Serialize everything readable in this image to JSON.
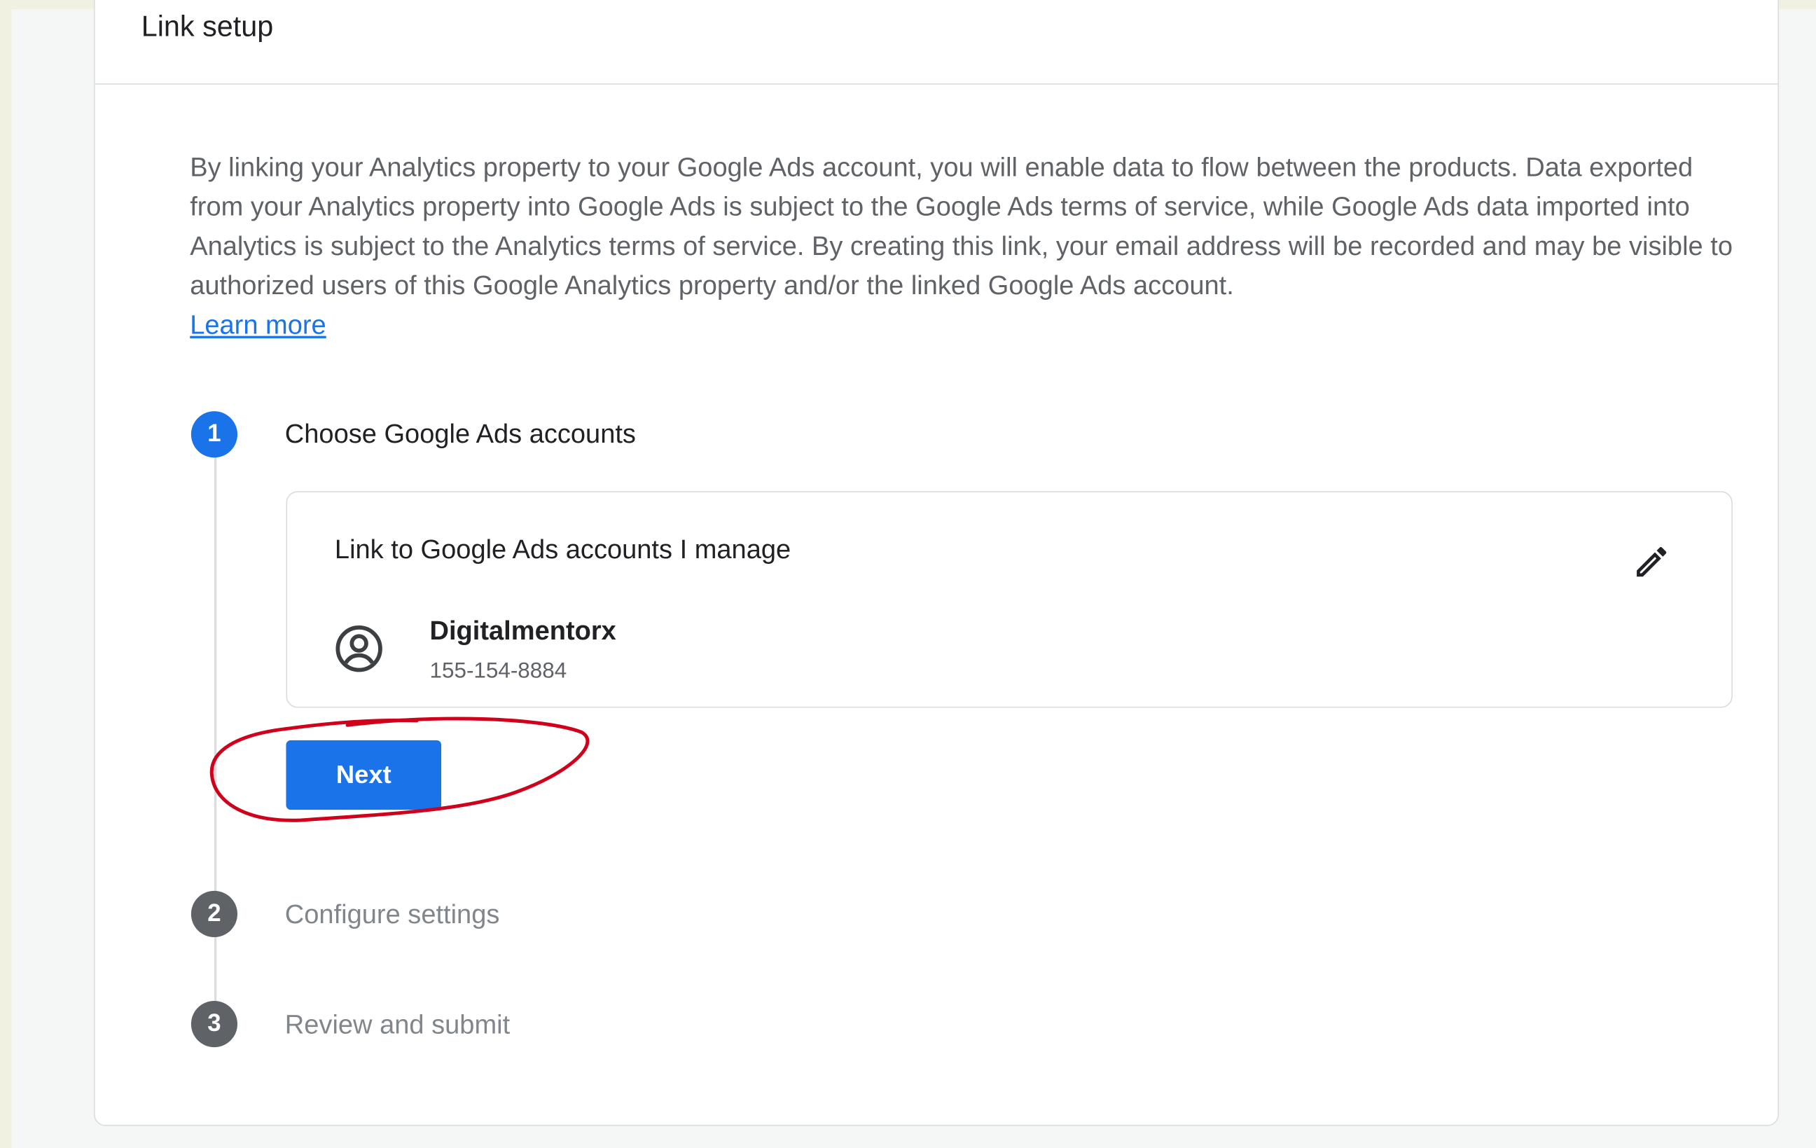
{
  "card": {
    "title": "Link setup",
    "intro_text": "By linking your Analytics property to your Google Ads account, you will enable data to flow between the products. Data exported from your Analytics property into Google Ads is subject to the Google Ads terms of service, while Google Ads data imported into Analytics is subject to the Analytics terms of service. By creating this link, your email address will be recorded and may be visible to authorized users of this Google Analytics property and/or the linked Google Ads account.",
    "learn_more": "Learn more"
  },
  "steps": [
    {
      "number": "1",
      "label": "Choose Google Ads accounts",
      "state": "active"
    },
    {
      "number": "2",
      "label": "Configure settings",
      "state": "inactive"
    },
    {
      "number": "3",
      "label": "Review and submit",
      "state": "inactive"
    }
  ],
  "account_box": {
    "title": "Link to Google Ads accounts I manage",
    "account_name": "Digitalmentorx",
    "account_id": "155-154-8884",
    "icons": {
      "edit": "pencil-icon",
      "account": "account-circle-icon"
    }
  },
  "next_button": {
    "label": "Next"
  },
  "colors": {
    "primary": "#1a73e8",
    "annotation": "#d0021b",
    "inactive_step": "#5f6368"
  }
}
